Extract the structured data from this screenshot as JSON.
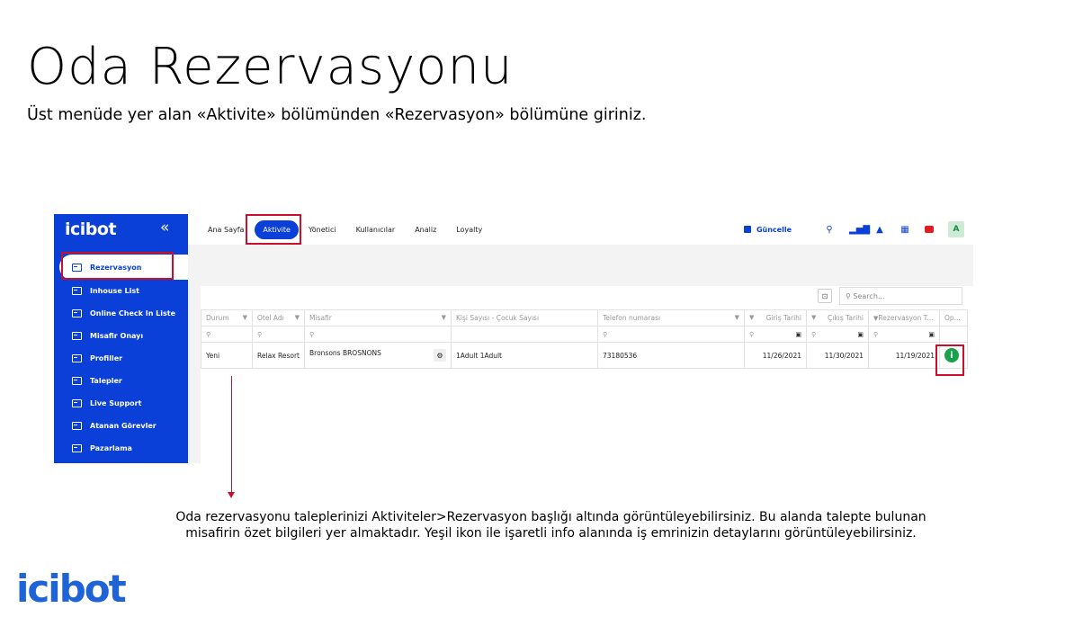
{
  "slide": {
    "title": "Oda Rezervasyonu",
    "subtitle": "Üst menüde yer alan «Aktivite» bölümünden «Rezervasyon» bölümüne giriniz.",
    "caption_line1": "Oda rezervasyonu taleplerinizi Aktiviteler>Rezervasyon başlığı altında görüntüleyebilirsiniz. Bu alanda talepte bulunan",
    "caption_line2": "misafirin özet bilgileri yer almaktadır. Yeşil ikon ile işaretli info alanında iş emrinizin detaylarını görüntüleyebilirsiniz.",
    "brand": "icibot"
  },
  "app": {
    "logo": "icibot",
    "collapse_icon": "«",
    "sidebar": [
      {
        "label": "Rezervasyon",
        "active": true
      },
      {
        "label": "Inhouse List"
      },
      {
        "label": "Online Check In Liste"
      },
      {
        "label": "Misafir Onayı"
      },
      {
        "label": "Profiller"
      },
      {
        "label": "Talepler"
      },
      {
        "label": "Live Support"
      },
      {
        "label": "Atanan Görevler"
      },
      {
        "label": "Pazarlama"
      }
    ],
    "nav": [
      "Ana Sayfa",
      "Aktivite",
      "Yönetici",
      "Kullanıcılar",
      "Analiz",
      "Loyalty"
    ],
    "save_label": "Güncelle",
    "avatar": "A",
    "search_placeholder": "Search...",
    "columns": [
      "Durum",
      "Otel Adı",
      "Misafir",
      "Kişi Sayısı - Çocuk Sayısı",
      "Telefon numarası",
      "Giriş Tarihi",
      "Çıkış Tarihi",
      "Rezervasyon T...",
      "Op..."
    ],
    "row": {
      "durum": "Yeni",
      "otel": "Relax Resort",
      "misafir": "Bronsons BROSNONS",
      "kisi": "1Adult 1Adult",
      "telefon": "73180536",
      "giris": "11/26/2021",
      "cikis": "11/30/2021",
      "rezervasyon": "11/19/2021"
    }
  },
  "colors": {
    "primary": "#0a3fd8",
    "highlight": "#c8102e",
    "info": "#17a34a",
    "brand": "#1f63d8"
  }
}
